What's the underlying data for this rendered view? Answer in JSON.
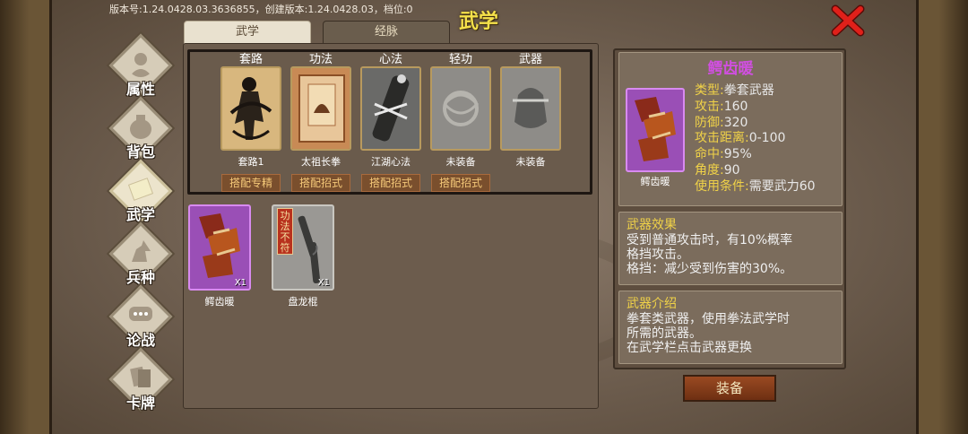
{
  "header": {
    "version_text": "版本号:1.24.0428.03.3636855，创建版本:1.24.0428.03，档位:0",
    "title": "武学"
  },
  "tabs": [
    {
      "label": "武学",
      "active": true
    },
    {
      "label": "经脉",
      "active": false
    }
  ],
  "sidebar": {
    "items": [
      {
        "label": "属性"
      },
      {
        "label": "背包"
      },
      {
        "label": "武学",
        "active": true
      },
      {
        "label": "兵种"
      },
      {
        "label": "论战"
      },
      {
        "label": "卡牌"
      }
    ]
  },
  "slots": [
    {
      "header": "套路",
      "name": "套路1",
      "button": "搭配专精"
    },
    {
      "header": "功法",
      "name": "太祖长拳",
      "button": "搭配招式"
    },
    {
      "header": "心法",
      "name": "江湖心法",
      "button": "搭配招式"
    },
    {
      "header": "轻功",
      "name": "未装备",
      "button": "搭配招式"
    },
    {
      "header": "武器",
      "name": "未装备",
      "button": ""
    }
  ],
  "inventory": [
    {
      "name": "鳄齿暖",
      "count": "X1",
      "badge": ""
    },
    {
      "name": "盘龙棍",
      "count": "X1",
      "badge": "功法不符"
    }
  ],
  "detail": {
    "title": "鳄齿暖",
    "card_name": "鳄齿暖",
    "stats": [
      {
        "key": "类型:",
        "value": "拳套武器"
      },
      {
        "key": "攻击:",
        "value": "160"
      },
      {
        "key": "防御:",
        "value": "320"
      },
      {
        "key": "攻击距离:",
        "value": "0-100"
      },
      {
        "key": "命中:",
        "value": "95%"
      },
      {
        "key": "角度:",
        "value": "90"
      },
      {
        "key": "使用条件:",
        "value": "需要武力60"
      }
    ],
    "effect_title": "武器效果",
    "effect_text": "受到普通攻击时，有10%概率\n格挡攻击。\n格挡：减少受到伤害的30%。",
    "intro_title": "武器介绍",
    "intro_text": "拳套类武器，使用拳法武学时\n所需的武器。\n在武学栏点击武器更换"
  },
  "buttons": {
    "equip": "装备"
  },
  "colors": {
    "title": "#f5e14a",
    "close": "#e0201a",
    "rarity_purple": "#9a4fb6",
    "stat_key": "#f0d248"
  }
}
